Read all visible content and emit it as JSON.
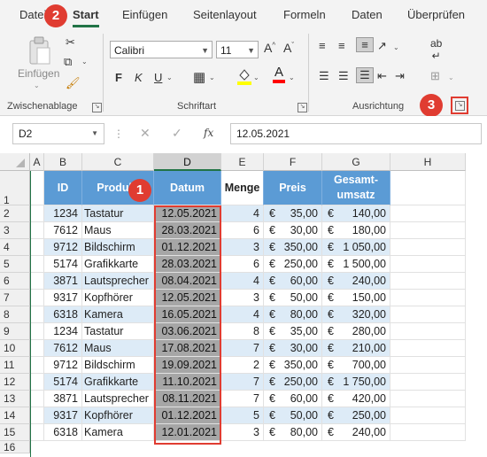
{
  "ribbon": {
    "tabs": [
      "Datei",
      "Start",
      "Einfügen",
      "Seitenlayout",
      "Formeln",
      "Daten",
      "Überprüfen"
    ],
    "active_tab": "Start",
    "clipboard": {
      "paste_label": "Einfügen",
      "group_label": "Zwischenablage"
    },
    "font": {
      "name": "Calibri",
      "size": "11",
      "bold": "F",
      "italic": "K",
      "underline": "U",
      "group_label": "Schriftart"
    },
    "alignment": {
      "group_label": "Ausrichtung"
    },
    "colors": {
      "accent": "#217346",
      "highlight": "#ffff00",
      "font_color": "#ff0000",
      "badge": "#e03c31"
    }
  },
  "badges": [
    "1",
    "2",
    "3"
  ],
  "formula_bar": {
    "name_box": "D2",
    "fx_label": "fx",
    "value": "12.05.2021"
  },
  "columns": [
    "A",
    "B",
    "C",
    "D",
    "E",
    "F",
    "G",
    "H"
  ],
  "selected_column": "D",
  "header_row": {
    "id": "ID",
    "produkt": "Produkt",
    "datum": "Datum",
    "menge": "Menge",
    "preis": "Preis",
    "gesamt1": "Gesamt-",
    "gesamt2": "umsatz"
  },
  "rows": [
    {
      "n": "2",
      "id": "1234",
      "produkt": "Tastatur",
      "datum": "12.05.2021",
      "menge": "4",
      "preis": "35,00",
      "gesamt": "140,00"
    },
    {
      "n": "3",
      "id": "7612",
      "produkt": "Maus",
      "datum": "28.03.2021",
      "menge": "6",
      "preis": "30,00",
      "gesamt": "180,00"
    },
    {
      "n": "4",
      "id": "9712",
      "produkt": "Bildschirm",
      "datum": "01.12.2021",
      "menge": "3",
      "preis": "350,00",
      "gesamt": "1 050,00"
    },
    {
      "n": "5",
      "id": "5174",
      "produkt": "Grafikkarte",
      "datum": "28.03.2021",
      "menge": "6",
      "preis": "250,00",
      "gesamt": "1 500,00"
    },
    {
      "n": "6",
      "id": "3871",
      "produkt": "Lautsprecher",
      "datum": "08.04.2021",
      "menge": "4",
      "preis": "60,00",
      "gesamt": "240,00"
    },
    {
      "n": "7",
      "id": "9317",
      "produkt": "Kopfhörer",
      "datum": "12.05.2021",
      "menge": "3",
      "preis": "50,00",
      "gesamt": "150,00"
    },
    {
      "n": "8",
      "id": "6318",
      "produkt": "Kamera",
      "datum": "16.05.2021",
      "menge": "4",
      "preis": "80,00",
      "gesamt": "320,00"
    },
    {
      "n": "9",
      "id": "1234",
      "produkt": "Tastatur",
      "datum": "03.06.2021",
      "menge": "8",
      "preis": "35,00",
      "gesamt": "280,00"
    },
    {
      "n": "10",
      "id": "7612",
      "produkt": "Maus",
      "datum": "17.08.2021",
      "menge": "7",
      "preis": "30,00",
      "gesamt": "210,00"
    },
    {
      "n": "11",
      "id": "9712",
      "produkt": "Bildschirm",
      "datum": "19.09.2021",
      "menge": "2",
      "preis": "350,00",
      "gesamt": "700,00"
    },
    {
      "n": "12",
      "id": "5174",
      "produkt": "Grafikkarte",
      "datum": "11.10.2021",
      "menge": "7",
      "preis": "250,00",
      "gesamt": "1 750,00"
    },
    {
      "n": "13",
      "id": "3871",
      "produkt": "Lautsprecher",
      "datum": "08.11.2021",
      "menge": "7",
      "preis": "60,00",
      "gesamt": "420,00"
    },
    {
      "n": "14",
      "id": "9317",
      "produkt": "Kopfhörer",
      "datum": "01.12.2021",
      "menge": "5",
      "preis": "50,00",
      "gesamt": "250,00"
    },
    {
      "n": "15",
      "id": "6318",
      "produkt": "Kamera",
      "datum": "12.01.2021",
      "menge": "3",
      "preis": "80,00",
      "gesamt": "240,00"
    }
  ],
  "currency": "€",
  "row_numbers": {
    "header": "1",
    "last": "16"
  }
}
